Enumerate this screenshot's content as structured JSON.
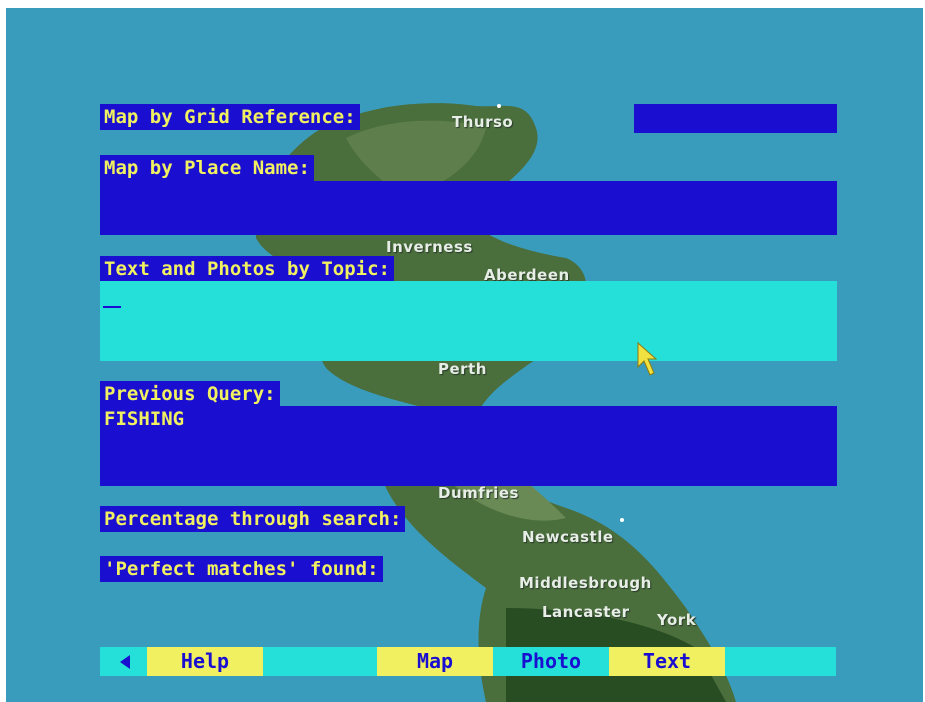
{
  "map": {
    "places": [
      "Thurso",
      "Inverness",
      "Aberdeen",
      "Perth",
      "Dumfries",
      "Newcastle",
      "Middlesbrough",
      "Lancaster",
      "York"
    ]
  },
  "form": {
    "grid_label": "Map by Grid Reference:",
    "grid_value": "",
    "place_label": "Map by Place Name:",
    "place_value": "",
    "topic_label": "Text and Photos by Topic:",
    "topic_value": "",
    "previous_label": "Previous Query:",
    "previous_value": "FISHING",
    "percentage_label": "Percentage through search:",
    "perfect_label": "'Perfect matches' found:"
  },
  "navbar": {
    "back_icon": "left-arrow-icon",
    "help": "Help",
    "map": "Map",
    "photo": "Photo",
    "text": "Text"
  },
  "colors": {
    "panel_blue": "#1a0fd0",
    "active_cyan": "#24e0d8",
    "label_yellow": "#f0f060",
    "sea": "#3a9cbd"
  }
}
